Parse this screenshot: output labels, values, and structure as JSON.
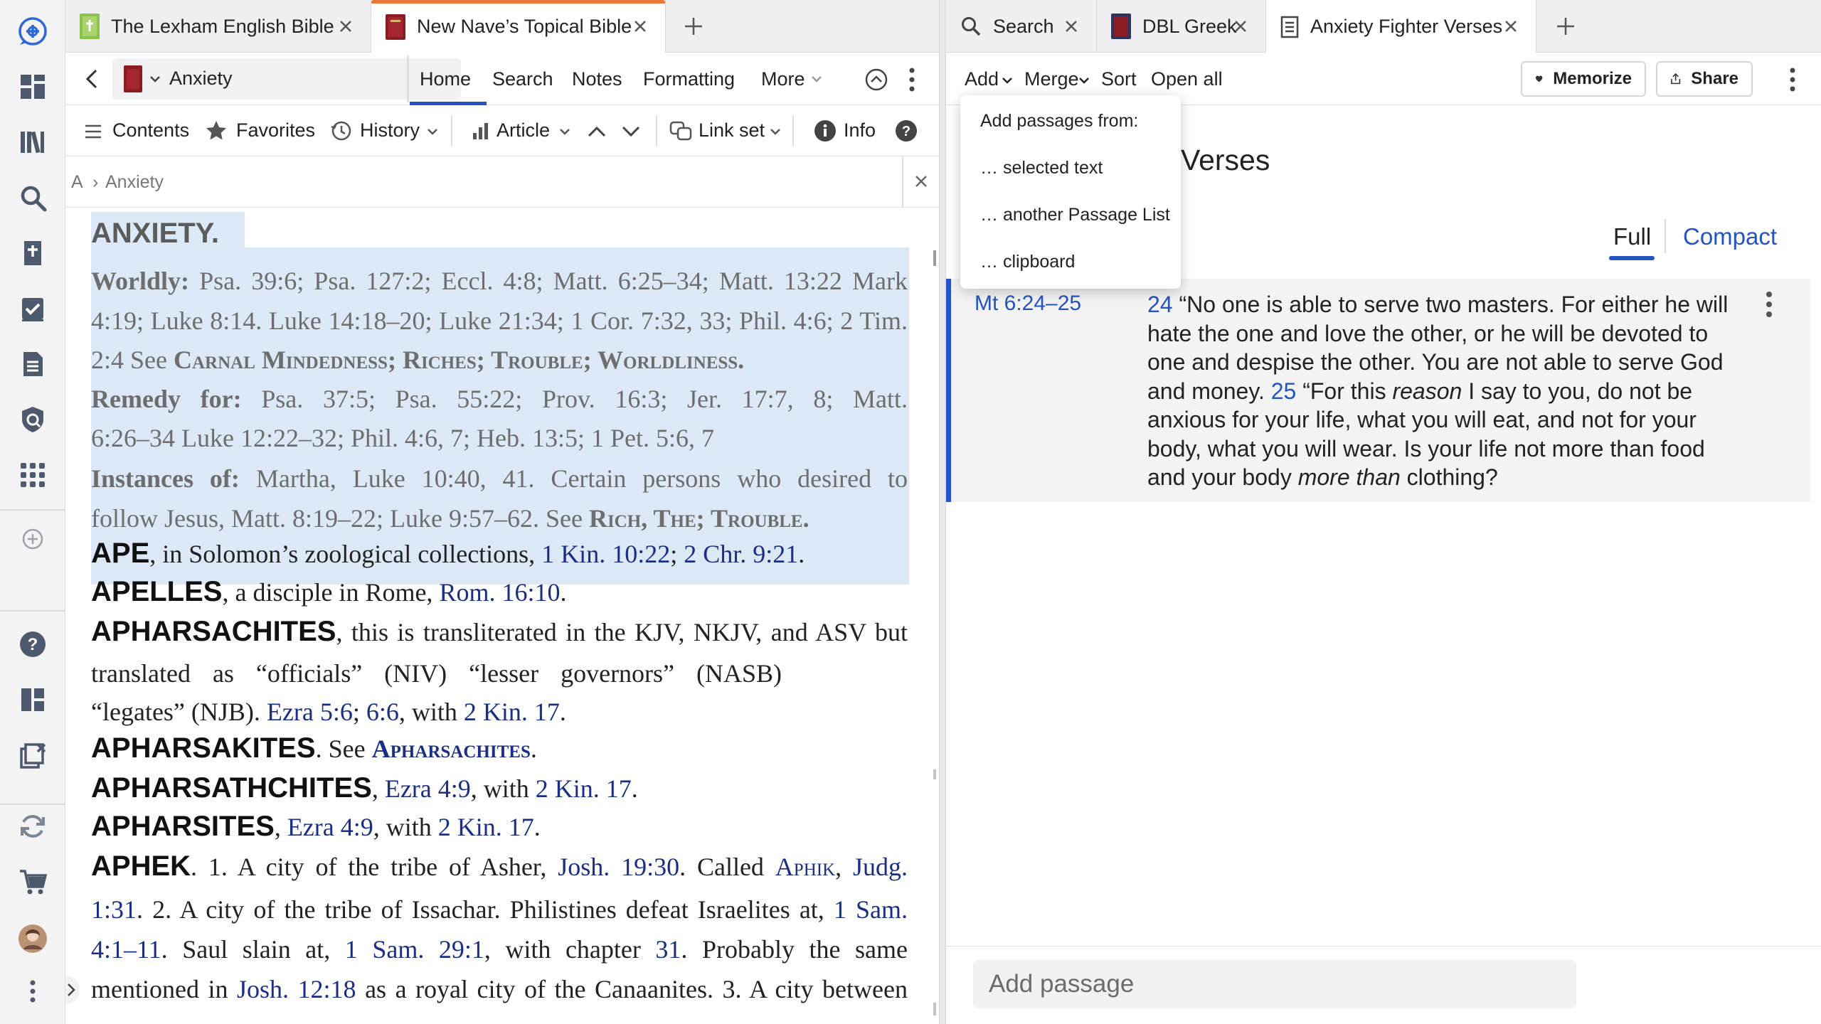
{
  "sidebar": {
    "icons": [
      "logos-home-icon",
      "dashboard-icon",
      "library-icon",
      "search-icon",
      "guides-icon",
      "documents-icon",
      "notes-icon",
      "factbook-icon",
      "tools-icon",
      "add-icon",
      "help-icon",
      "layouts-icon",
      "close-panels-icon",
      "sync-icon",
      "cart-icon",
      "avatar",
      "more-icon"
    ]
  },
  "left_tabs": [
    {
      "label": "The Lexham English Bible"
    },
    {
      "label": "New Nave’s Topical Bible"
    }
  ],
  "left_header": {
    "resource_title": "Anxiety",
    "nav": [
      "Home",
      "Search",
      "Notes",
      "Formatting",
      "More"
    ]
  },
  "left_toolbar": {
    "contents": "Contents",
    "favorites": "Favorites",
    "history": "History",
    "article": "Article",
    "link_set": "Link set",
    "info": "Info"
  },
  "breadcrumb": {
    "letter": "A",
    "sep": "›",
    "current": "Anxiety"
  },
  "article": {
    "l1": "ANXIETY.",
    "l2a": "Worldly:",
    "l2b": " Psa. 39:6; Psa. 127:2; Eccl. 4:8; Matt. 6:25–34; Matt. 13:22 Mark",
    "l3": "4:19; Luke 8:14. Luke 14:18–20; Luke 21:34; 1 Cor. 7:32, 33; Phil. 4:6; 2 Tim.",
    "l4a": "2:4 See ",
    "l4b": "Carnal Mindedness; Riches; Trouble; Worldliness.",
    "l5a": "Remedy for:",
    "l5b": " Psa. 37:5; Psa. 55:22; Prov. 16:3; Jer. 17:7, 8; Matt.",
    "l6": "6:26–34 Luke 12:22–32; Phil. 4:6, 7; Heb. 13:5; 1 Pet. 5:6, 7",
    "l7a": "Instances of:",
    "l7b": " Martha, Luke 10:40, 41. Certain persons who desired to",
    "l8a": "follow Jesus, Matt. 8:19–22; Luke 9:57–62. See ",
    "l8b": "Rich, The; Trouble.",
    "ape_hw": "APE",
    "ape_t1": ", in Solomon’s zoological collections, ",
    "ape_r1": "1 Kin. 10:22",
    "ape_t2": "; ",
    "ape_r2": "2 Chr. 9:21",
    "ape_t3": ".",
    "apelles_hw": "APELLES",
    "apelles_t1": ", a disciple in Rome, ",
    "apelles_r1": "Rom. 16:10",
    "apelles_t2": ".",
    "aphar_hw": "APHARSACHITES",
    "aphar_t1": ", this is transliterated in the KJV, NKJV, and ASV but",
    "aphar_l2": "translated as “officials” (NIV) “lesser governors” (NASB)",
    "aphar_l3a": "“legates” (NJB). ",
    "aphar_r1": "Ezra 5:6",
    "aphar_t2": "; ",
    "aphar_r2": "6:6",
    "aphar_t3": ", with ",
    "aphar_r3": "2 Kin. 17",
    "aphar_t4": ".",
    "apharsakites_hw": "APHARSAKITES",
    "apharsakites_t1": ". See ",
    "apharsakites_r1": "Apharsachites",
    "apharsakites_t2": ".",
    "apharsath_hw": "APHARSATHCHITES",
    "apharsath_t1": ", ",
    "apharsath_r1": "Ezra 4:9",
    "apharsath_t2": ", with ",
    "apharsath_r2": "2 Kin. 17",
    "apharsath_t3": ".",
    "apharsites_hw": "APHARSITES",
    "apharsites_t1": ", ",
    "apharsites_r1": "Ezra 4:9",
    "apharsites_t2": ", with ",
    "apharsites_r2": "2 Kin. 17",
    "apharsites_t3": ".",
    "aphek_hw": "APHEK",
    "aphek_t1": ". 1. A city of the tribe of Asher, ",
    "aphek_r1": "Josh. 19:30",
    "aphek_t2": ". Called ",
    "aphek_r2": "Aphik",
    "aphek_t3": ", ",
    "aphek_r3": "Judg.",
    "aphek_l2a": "1:31",
    "aphek_l2b": ". 2. A city of the tribe of Issachar. Philistines defeat Israelites at, ",
    "aphek_l2c": "1 Sam.",
    "aphek_l3a": "4:1–11",
    "aphek_l3b": ". Saul slain at, ",
    "aphek_l3c": "1 Sam. 29:1",
    "aphek_l3d": ", with chapter ",
    "aphek_l3e": "31",
    "aphek_l3f": ". Probably the same",
    "aphek_l4a": "mentioned in ",
    "aphek_l4b": "Josh. 12:18",
    "aphek_l4c": " as a royal city of the Canaanites. 3. A city between"
  },
  "right_tabs": [
    {
      "label": "Search"
    },
    {
      "label": "DBL Greek"
    },
    {
      "label": "Anxiety Fighter Verses"
    }
  ],
  "right_toolbar": {
    "add": "Add",
    "merge": "Merge",
    "sort": "Sort",
    "open_all": "Open all",
    "memorize": "Memorize",
    "share": "Share"
  },
  "passage_list": {
    "title_visible": "Verses",
    "view_full": "Full",
    "view_compact": "Compact",
    "entry_ref": "Mt 6:24–25",
    "v24": "24",
    "l1": " “No one is able to serve two masters. For either he will",
    "l2": "hate the one and love the other, or he will be devoted to",
    "l3": "one and despise the other. You are not able to serve God",
    "l4a": "and money. ",
    "v25": "25",
    "l4b": " “For this ",
    "l4c": "reason",
    "l4d": " I say to you, do not be",
    "l5": "anxious for your life, what you will eat, and not for your",
    "l6": "body, what you will wear. Is your life not more than food",
    "l7a": "and your body ",
    "l7b": "more than",
    "l7c": " clothing?",
    "add_passage_placeholder": "Add passage"
  },
  "add_menu": {
    "header": "Add passages from:",
    "items": [
      "… selected text",
      "… another Passage List",
      "… clipboard"
    ]
  },
  "colors": {
    "accent_blue": "#2553c2",
    "link_navy": "#1b2e86",
    "highlight": "#dde8f6",
    "tab_orange": "#e8773a",
    "logos_blue": "#2e67d8"
  }
}
